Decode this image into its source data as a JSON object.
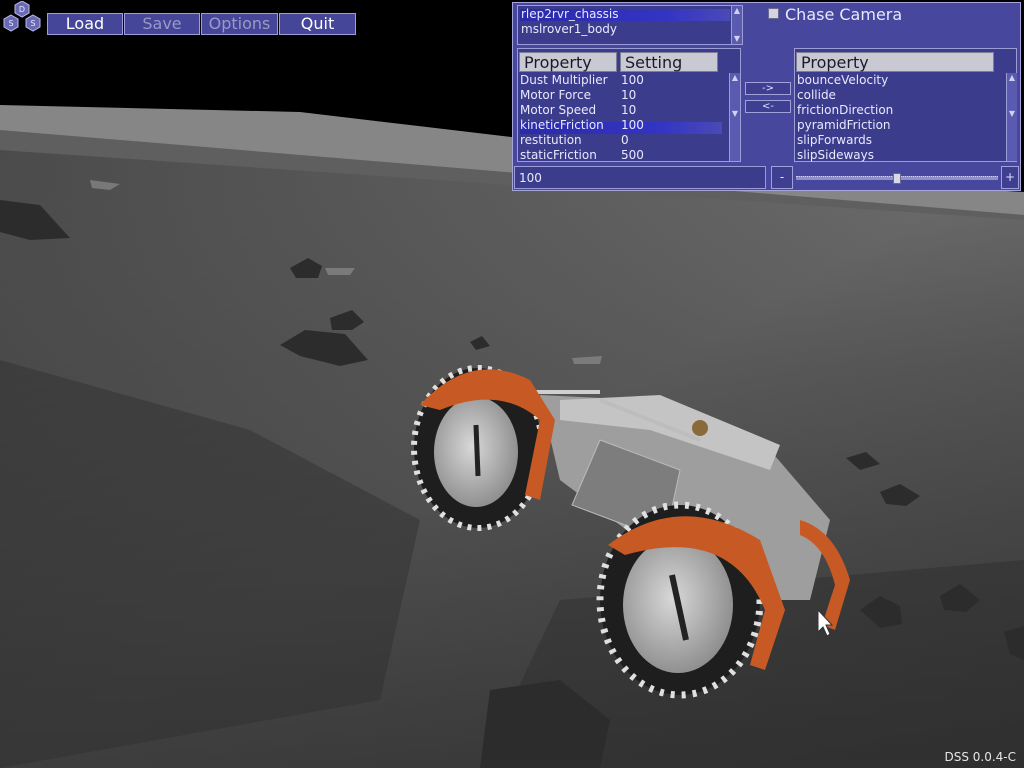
{
  "app": {
    "logo_letters": [
      "D",
      "S",
      "S"
    ],
    "version": "DSS 0.0.4-C"
  },
  "menu": {
    "items": [
      {
        "label": "Load",
        "enabled": true
      },
      {
        "label": "Save",
        "enabled": false
      },
      {
        "label": "Options",
        "enabled": false
      },
      {
        "label": "Quit",
        "enabled": true
      }
    ]
  },
  "panel": {
    "bodies": [
      "rlep2rvr_chassis",
      "mslrover1_body"
    ],
    "selected_body_index": 0,
    "chase_camera": {
      "label": "Chase Camera",
      "checked": false
    },
    "left_table": {
      "headers": [
        "Property",
        "Setting"
      ],
      "rows": [
        {
          "property": "Dust Multiplier",
          "setting": "100"
        },
        {
          "property": "Motor Force",
          "setting": "10"
        },
        {
          "property": "Motor Speed",
          "setting": "10"
        },
        {
          "property": "kineticFriction",
          "setting": "100"
        },
        {
          "property": "restitution",
          "setting": "0"
        },
        {
          "property": "staticFriction",
          "setting": "500"
        }
      ],
      "selected_row_index": 3
    },
    "transfer": {
      "add_label": "->",
      "remove_label": "<-"
    },
    "right_table": {
      "header": "Property",
      "rows": [
        "bounceVelocity",
        "collide",
        "frictionDirection",
        "pyramidFriction",
        "slipForwards",
        "slipSideways"
      ]
    },
    "value_input": "100",
    "slider": {
      "minus_label": "-",
      "plus_label": "+",
      "value_fraction": 0.5
    }
  },
  "colors": {
    "panel_bg": "#47479d",
    "selection": "#3030c0",
    "rover_orange": "#c75a24"
  }
}
